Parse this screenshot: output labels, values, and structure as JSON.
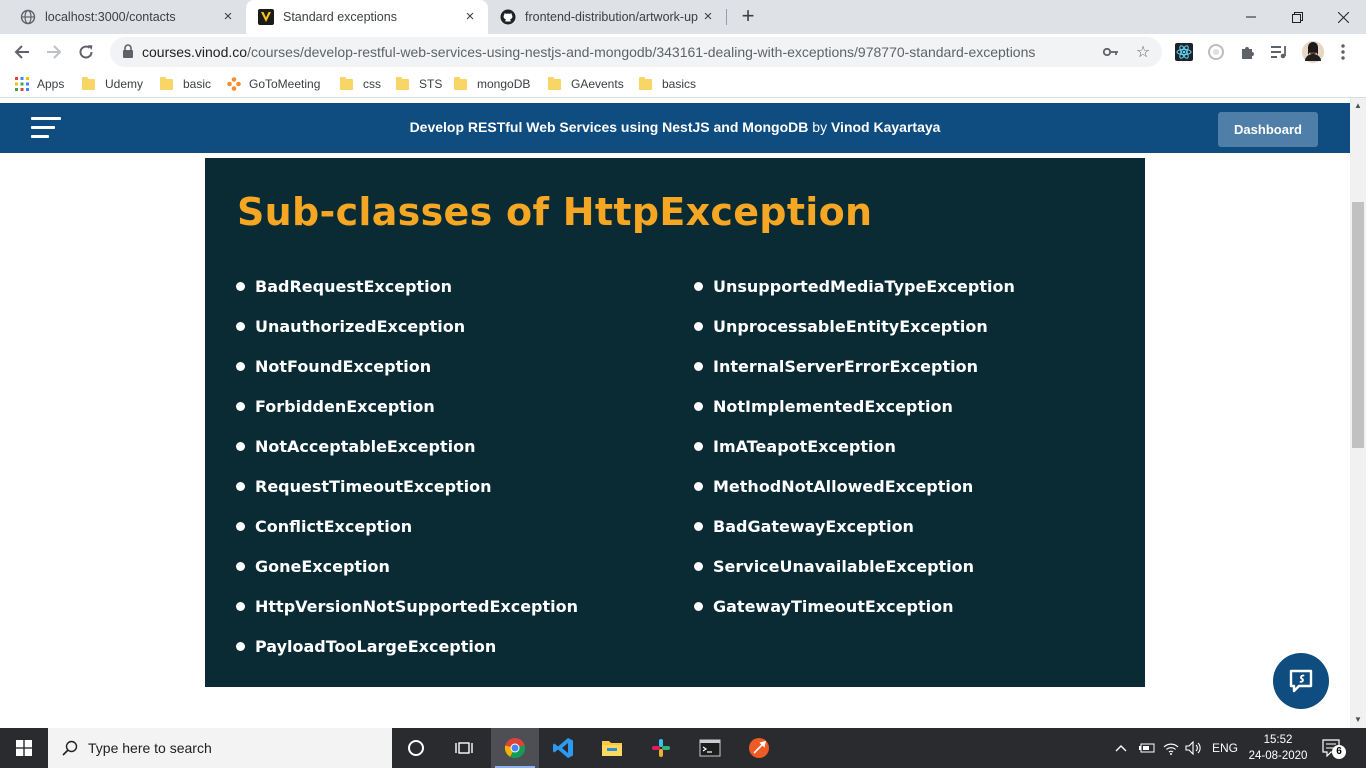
{
  "browser": {
    "tabs": [
      {
        "title": "localhost:3000/contacts",
        "active": false
      },
      {
        "title": "Standard exceptions",
        "active": true
      },
      {
        "title": "frontend-distribution/artwork-up",
        "active": false
      }
    ],
    "url_host": "courses.vinod.co",
    "url_path": "/courses/develop-restful-web-services-using-nestjs-and-mongodb/343161-dealing-with-exceptions/978770-standard-exceptions",
    "bookmarks": [
      "Apps",
      "Udemy",
      "basic",
      "GoToMeeting",
      "css",
      "STS",
      "mongoDB",
      "GAevents",
      "basics"
    ]
  },
  "header": {
    "course_title": "Develop RESTful Web Services using NestJS and MongoDB",
    "by_text": "by",
    "author": "Vinod Kayartaya",
    "dashboard_label": "Dashboard"
  },
  "slide": {
    "title": "Sub-classes of HttpException",
    "left_items": [
      "BadRequestException",
      "UnauthorizedException",
      "NotFoundException",
      "ForbiddenException",
      "NotAcceptableException",
      "RequestTimeoutException",
      "ConflictException",
      "GoneException",
      "HttpVersionNotSupportedException",
      "PayloadTooLargeException"
    ],
    "right_items": [
      "UnsupportedMediaTypeException",
      "UnprocessableEntityException",
      "InternalServerErrorException",
      "NotImplementedException",
      "ImATeapotException",
      "MethodNotAllowedException",
      "BadGatewayException",
      "ServiceUnavailableException",
      "GatewayTimeoutException"
    ]
  },
  "taskbar": {
    "search_placeholder": "Type here to search",
    "language": "ENG",
    "time": "15:52",
    "date": "24-08-2020",
    "notification_count": "6"
  },
  "colors": {
    "header_bg": "#0f4c7f",
    "slide_bg": "#0a2b33",
    "slide_title": "#f5a623"
  }
}
